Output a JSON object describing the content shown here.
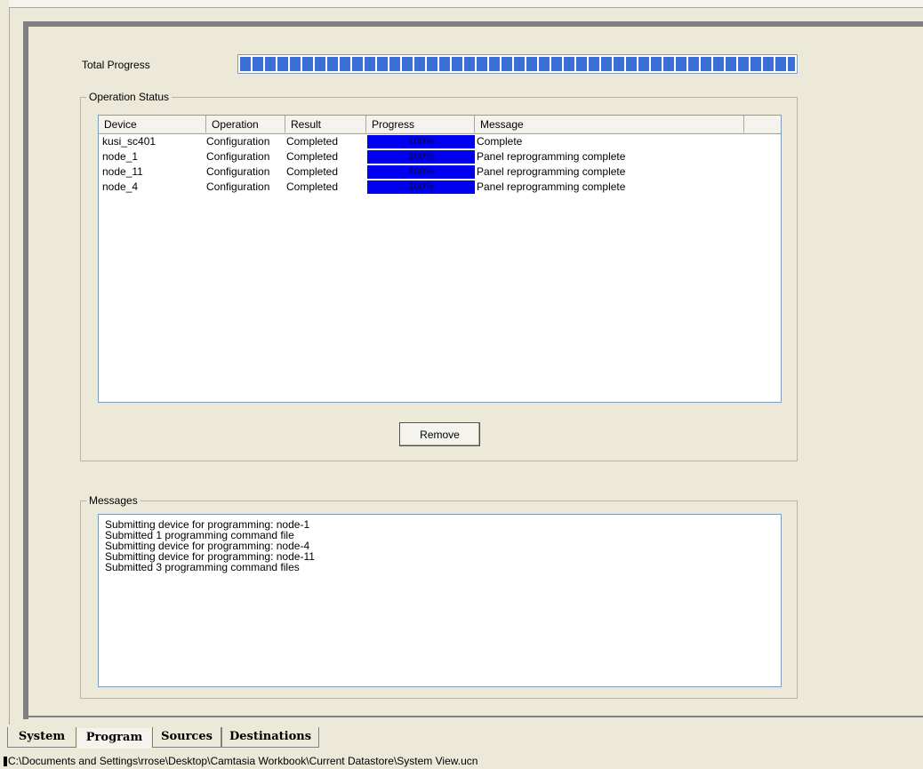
{
  "total_progress": {
    "label": "Total Progress",
    "percent": 100
  },
  "operation_status": {
    "group_label": "Operation Status",
    "columns": [
      "Device",
      "Operation",
      "Result",
      "Progress",
      "Message",
      ""
    ],
    "rows": [
      {
        "device": "kusi_sc401",
        "operation": "Configuration",
        "result": "Completed",
        "progress": "100%",
        "message": "Complete"
      },
      {
        "device": "node_1",
        "operation": "Configuration",
        "result": "Completed",
        "progress": "100%",
        "message": "Panel reprogramming complete"
      },
      {
        "device": "node_11",
        "operation": "Configuration",
        "result": "Completed",
        "progress": "100%",
        "message": "Panel reprogramming complete"
      },
      {
        "device": "node_4",
        "operation": "Configuration",
        "result": "Completed",
        "progress": "100%",
        "message": "Panel reprogramming complete"
      }
    ],
    "progress_color": "#0000f0"
  },
  "remove_button": {
    "label": "Remove"
  },
  "messages": {
    "group_label": "Messages",
    "lines": [
      "Submitting device for programming: node-1",
      "Submitted 1 programming command file",
      "Submitting device for programming: node-4",
      "Submitting device for programming: node-11",
      "Submitted 3 programming command files"
    ]
  },
  "tabs": [
    {
      "label": "System",
      "active": false
    },
    {
      "label": "Program",
      "active": true
    },
    {
      "label": "Sources",
      "active": false
    },
    {
      "label": "Destinations",
      "active": false
    }
  ],
  "status_bar": {
    "path": "C:\\Documents and Settings\\rrose\\Desktop\\Camtasia Workbook\\Current Datastore\\System View.ucn"
  }
}
